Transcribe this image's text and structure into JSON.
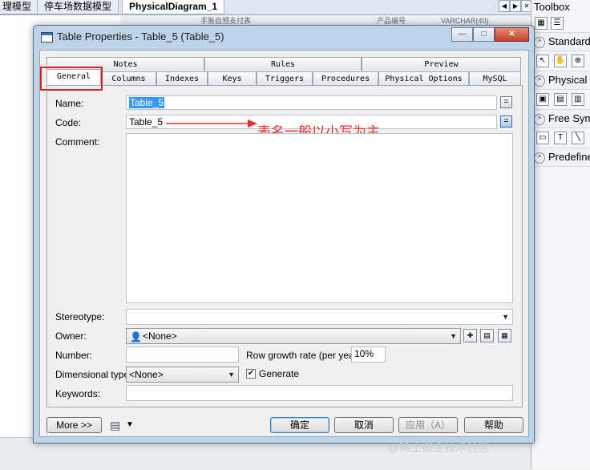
{
  "background": {
    "tabs": [
      "理模型",
      "停车场数据模型",
      "PhysicalDiagram_1"
    ],
    "strip_texts": [
      "手账自预支付表",
      "产品编号",
      "VARCHAR(40)"
    ]
  },
  "toolbox": {
    "title": "Toolbox",
    "sections": [
      "Standard",
      "Physical",
      "Free Sym",
      "Predefine"
    ]
  },
  "dialog": {
    "title": "Table Properties - Table_5 (Table_5)",
    "window_buttons": {
      "minimize": "—",
      "maximize": "□",
      "close": "✕"
    },
    "tabs_row1": [
      "Notes",
      "Rules",
      "Preview"
    ],
    "tabs_row2": [
      "General",
      "Columns",
      "Indexes",
      "Keys",
      "Triggers",
      "Procedures",
      "Physical Options",
      "MySQL"
    ],
    "selected_tab": "General",
    "form": {
      "name_label": "Name:",
      "name_value": "Table_5",
      "code_label": "Code:",
      "code_value": "Table_5",
      "comment_label": "Comment:",
      "comment_value": "",
      "stereotype_label": "Stereotype:",
      "stereotype_value": "",
      "owner_label": "Owner:",
      "owner_value": "<None>",
      "number_label": "Number:",
      "number_value": "",
      "row_growth_label": "Row growth rate (per year):",
      "row_growth_value": "10%",
      "dimensional_label": "Dimensional type:",
      "dimensional_value": "<None>",
      "generate_label": "Generate",
      "generate_checked": true,
      "keywords_label": "Keywords:",
      "keywords_value": ""
    },
    "annotation": "表名一般以小写为主",
    "buttons": {
      "more": "More >>",
      "ok": "确定",
      "cancel": "取消",
      "apply": "应用（A）",
      "help": "帮助"
    }
  },
  "watermark": "@稀土掘金技术社区",
  "colors": {
    "annotation": "#e83030",
    "title_bar": "#bcd3ea",
    "selection": "#3399ff"
  }
}
